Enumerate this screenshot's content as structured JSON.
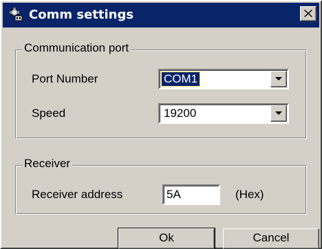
{
  "window": {
    "title": "Comm settings",
    "close_symbol": "×",
    "icon": "settings-plug-icon"
  },
  "communication_port": {
    "legend": "Communication port",
    "port_number_label": "Port Number",
    "port_number_value": "COM1",
    "speed_label": "Speed",
    "speed_value": "19200"
  },
  "receiver": {
    "legend": "Receiver",
    "address_label": "Receiver address",
    "address_value": "5A",
    "unit": "(Hex)"
  },
  "buttons": {
    "ok_label": "Ok",
    "cancel_label": "Cancel"
  },
  "colors": {
    "titlebar": "#0a246a",
    "face": "#d4d0c8",
    "selection": "#0a246a"
  }
}
